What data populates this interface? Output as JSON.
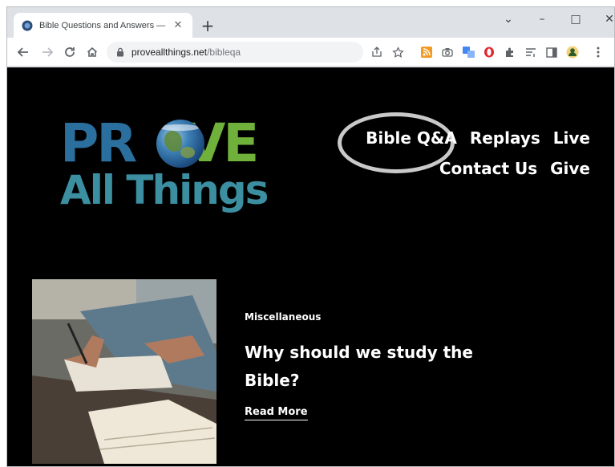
{
  "browser": {
    "tab": {
      "title": "Bible Questions and Answers —",
      "close_glyph": "✕"
    },
    "new_tab_glyph": "+",
    "window_controls": {
      "collapse_glyph": "⌄",
      "minimize_glyph": "–",
      "maximize_glyph": "□",
      "close_glyph": "✕"
    },
    "url": {
      "host": "proveallthings.net",
      "path": "/bibleqa"
    },
    "toolbar_icons": [
      "share-icon",
      "star-icon",
      "rss-extension-icon",
      "camera-extension-icon",
      "translate-extension-icon",
      "opera-extension-icon",
      "puzzle-extensions-icon",
      "reading-list-icon",
      "side-panel-icon",
      "profile-avatar-icon",
      "menu-kebab-icon"
    ]
  },
  "site": {
    "logo": {
      "line1_part1": "PR",
      "line1_part2": "VE",
      "line2": "All Things"
    },
    "nav": {
      "row1": [
        "Bible Q&A",
        "Replays",
        "Live"
      ],
      "row2": [
        "Contact Us",
        "Give"
      ]
    },
    "article": {
      "category": "Miscellaneous",
      "title": "Why should we study the Bible?",
      "read_more": "Read More"
    }
  },
  "colors": {
    "page_background": "#000000",
    "logo_blue": "#2a6f9e",
    "logo_green": "#6fb13a",
    "logo_teal": "#3b8fa0",
    "highlight_ring": "#c9c9c9"
  }
}
